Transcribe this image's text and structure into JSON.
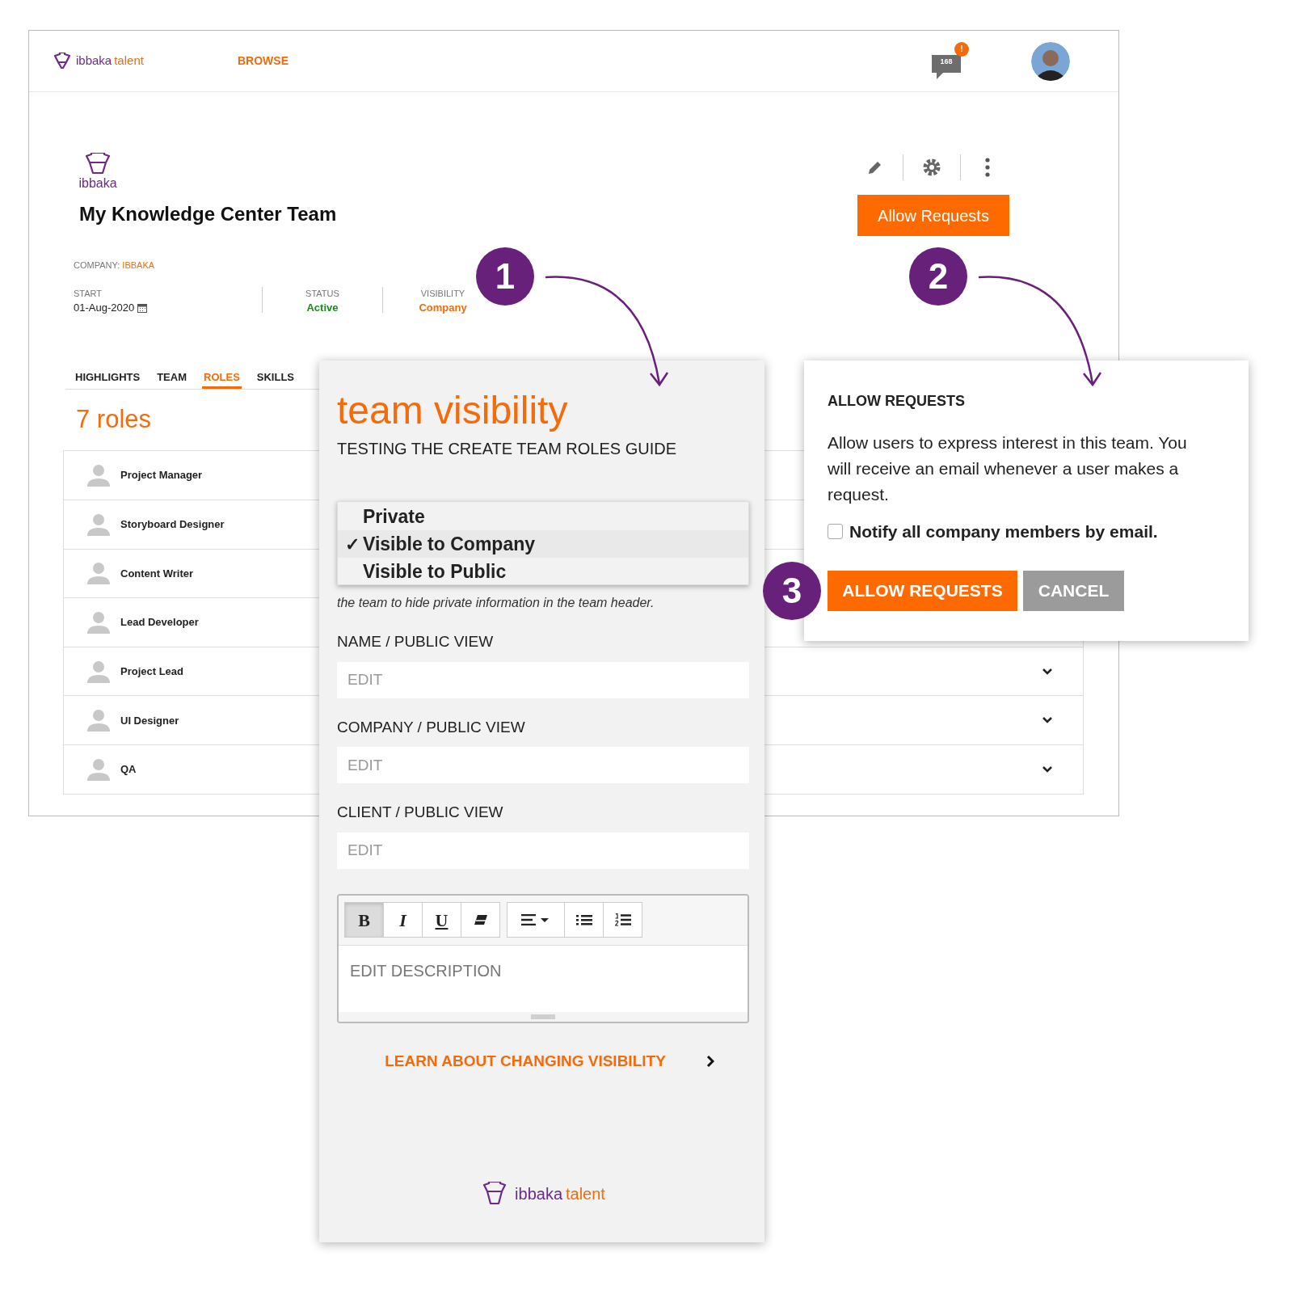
{
  "app": {
    "brand": "ibbaka",
    "product": "talent",
    "nav": [
      {
        "label": "BROWSE",
        "selected": true
      }
    ],
    "messages": {
      "count": "168",
      "badge": "!"
    }
  },
  "team": {
    "logo_text": "ibbaka",
    "title": "My Knowledge Center Team",
    "allow_button": "Allow Requests",
    "company_label": "COMPANY:",
    "company": "IBBAKA",
    "fields": [
      {
        "label": "START",
        "value": "01-Aug-2020",
        "kind": "date"
      },
      {
        "label": "STATUS",
        "value": "Active",
        "kind": "status",
        "color": "#1f8a1f"
      },
      {
        "label": "VISIBILITY",
        "value": "Company",
        "kind": "status",
        "color": "#f26b0c"
      }
    ]
  },
  "tabs": [
    {
      "label": "HIGHLIGHTS",
      "selected": false
    },
    {
      "label": "TEAM",
      "selected": false
    },
    {
      "label": "ROLES",
      "selected": true
    },
    {
      "label": "SKILLS",
      "selected": false
    }
  ],
  "roles_title": "7 roles",
  "roles": [
    {
      "name": "Project Manager"
    },
    {
      "name": "Storyboard Designer"
    },
    {
      "name": "Content Writer"
    },
    {
      "name": "Lead Developer"
    },
    {
      "name": "Project Lead"
    },
    {
      "name": "UI Designer"
    },
    {
      "name": "QA"
    }
  ],
  "visibility_panel": {
    "title": "team visibility",
    "subtitle": "TESTING THE CREATE TEAM ROLES GUIDE",
    "options": [
      {
        "label": "Private",
        "selected": false
      },
      {
        "label": "Visible to Company",
        "selected": true
      },
      {
        "label": "Visible to Public",
        "selected": false
      }
    ],
    "check_mark": "✓",
    "note": "the team to hide private information in the team header.",
    "fields": [
      {
        "label": "NAME / PUBLIC VIEW",
        "placeholder": "EDIT"
      },
      {
        "label": "COMPANY / PUBLIC VIEW",
        "placeholder": "EDIT"
      },
      {
        "label": "CLIENT / PUBLIC VIEW",
        "placeholder": "EDIT"
      }
    ],
    "toolbar": [
      {
        "kind": "bold",
        "label": "B",
        "selected": true
      },
      {
        "kind": "italic",
        "label": "I",
        "selected": false
      },
      {
        "kind": "underline",
        "label": "U",
        "selected": false
      },
      {
        "kind": "eraser",
        "selected": false
      },
      {
        "kind": "align",
        "selected": false
      },
      {
        "kind": "bullets",
        "selected": false
      },
      {
        "kind": "numbers",
        "selected": false
      }
    ],
    "editor_placeholder": "EDIT DESCRIPTION",
    "link": "LEARN ABOUT CHANGING VISIBILITY",
    "footer_brand": "ibbaka",
    "footer_product": "talent"
  },
  "allow_panel": {
    "heading": "ALLOW REQUESTS",
    "text": "Allow users to express interest in this team. You will receive an email whenever a user makes a request.",
    "checkbox": {
      "label": "Notify all company members by email.",
      "checked": false
    },
    "buttons": [
      {
        "label": "ALLOW REQUESTS",
        "kind": "primary"
      },
      {
        "label": "CANCEL",
        "kind": "secondary"
      }
    ]
  },
  "callouts": [
    {
      "number": "1"
    },
    {
      "number": "2"
    },
    {
      "number": "3"
    }
  ]
}
